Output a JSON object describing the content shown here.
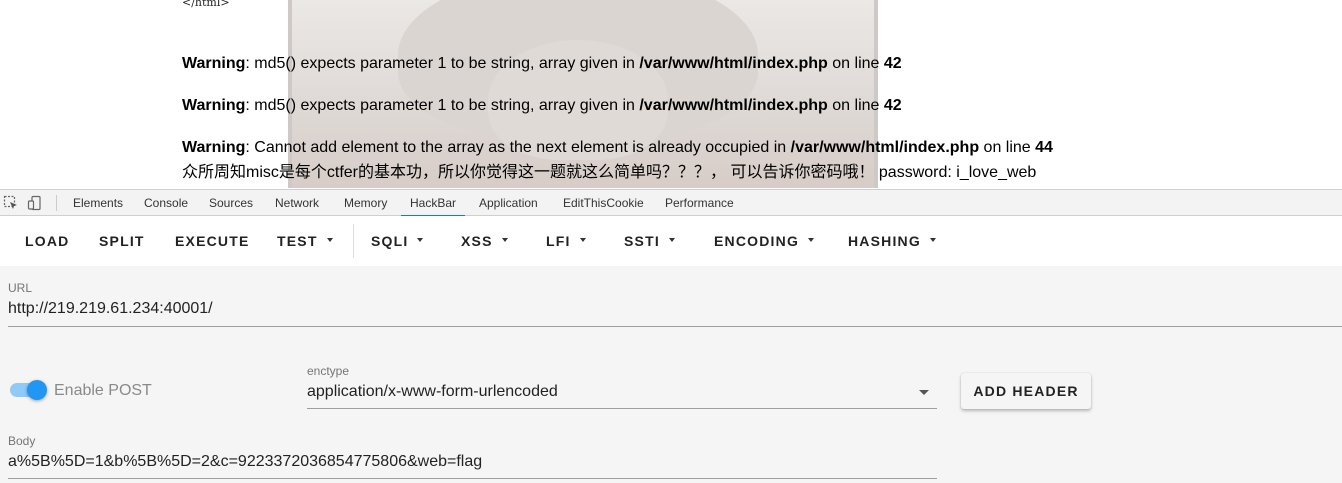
{
  "page": {
    "html_close_tag": "</html>",
    "warnings": [
      {
        "label": "Warning",
        "message": ": md5() expects parameter 1 to be string, array given in ",
        "file": "/var/www/html/index.php",
        "on_line": " on line ",
        "line": "42"
      },
      {
        "label": "Warning",
        "message": ": md5() expects parameter 1 to be string, array given in ",
        "file": "/var/www/html/index.php",
        "on_line": " on line ",
        "line": "42"
      },
      {
        "label": "Warning",
        "message": ": Cannot add element to the array as the next element is already occupied in ",
        "file": "/var/www/html/index.php",
        "on_line": " on line ",
        "line": "44"
      }
    ],
    "message_line": "众所周知misc是每个ctfer的基本功，所以你觉得这一题就这么简单吗？？？， 可以告诉你密码哦！ password: i_love_web"
  },
  "devtools": {
    "tabs": [
      "Elements",
      "Console",
      "Sources",
      "Network",
      "Memory",
      "HackBar",
      "Application",
      "EditThisCookie",
      "Performance"
    ],
    "active_tab": "HackBar",
    "icons": [
      "inspect-element-icon",
      "device-toolbar-icon"
    ]
  },
  "hackbar": {
    "toolbar": {
      "load": "LOAD",
      "split": "SPLIT",
      "execute": "EXECUTE",
      "test": "TEST",
      "sqli": "SQLI",
      "xss": "XSS",
      "lfi": "LFI",
      "ssti": "SSTI",
      "encoding": "ENCODING",
      "hashing": "HASHING"
    },
    "url_label": "URL",
    "url_value": "http://219.219.61.234:40001/",
    "enable_post_label": "Enable POST",
    "enable_post_on": true,
    "enctype_label": "enctype",
    "enctype_value": "application/x-www-form-urlencoded",
    "add_header_label": "ADD HEADER",
    "body_label": "Body",
    "body_value": "a%5B%5D=1&b%5B%5D=2&c=9223372036854775806&web=flag"
  },
  "colors": {
    "accent": "#1a73e8",
    "switch_knob": "#2196f3",
    "switch_track": "#90caf9"
  }
}
